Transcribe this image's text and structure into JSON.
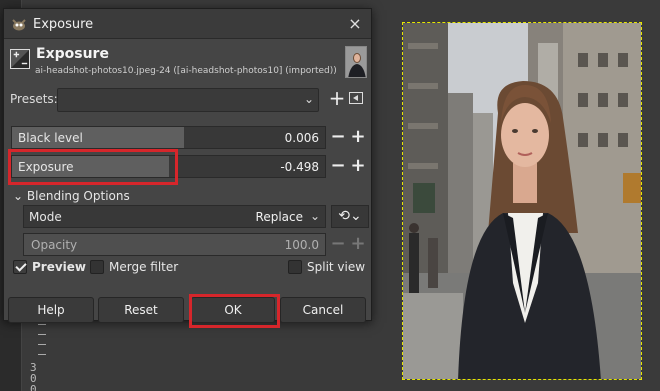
{
  "dialog": {
    "title": "Exposure",
    "close_glyph": "×",
    "header": {
      "title": "Exposure",
      "subtitle": "ai-headshot-photos10.jpeg-24 ([ai-headshot-photos10] (imported))"
    },
    "presets": {
      "label": "Presets:",
      "value": "",
      "add_glyph": "+",
      "chevron_glyph": "⌄"
    },
    "black_level": {
      "label": "Black level",
      "value": "0.006",
      "fill_fraction": 0.55
    },
    "exposure": {
      "label": "Exposure",
      "value": "-0.498",
      "fill_fraction": 0.5
    },
    "stepper_minus": "−",
    "stepper_plus": "+",
    "blending": {
      "header": "Blending Options",
      "toggle_glyph": "⌄",
      "mode_label": "Mode",
      "mode_value": "Replace",
      "mode_chevron": "⌄",
      "composite_glyph": "⟲⌄",
      "opacity_label": "Opacity",
      "opacity_value": "100.0"
    },
    "preview": {
      "label": "Preview",
      "checked": true
    },
    "merge_filter": {
      "label": "Merge filter",
      "checked": false
    },
    "split_view": {
      "label": "Split view",
      "checked": false
    },
    "buttons": {
      "help": "Help",
      "reset": "Reset",
      "ok": "OK",
      "cancel": "Cancel"
    }
  },
  "ruler": {
    "marks": [
      "3",
      "0",
      "0"
    ]
  },
  "colors": {
    "highlight": "#d6262b",
    "selection_marquee": "#e6e600",
    "dialog_bg": "#454545"
  }
}
